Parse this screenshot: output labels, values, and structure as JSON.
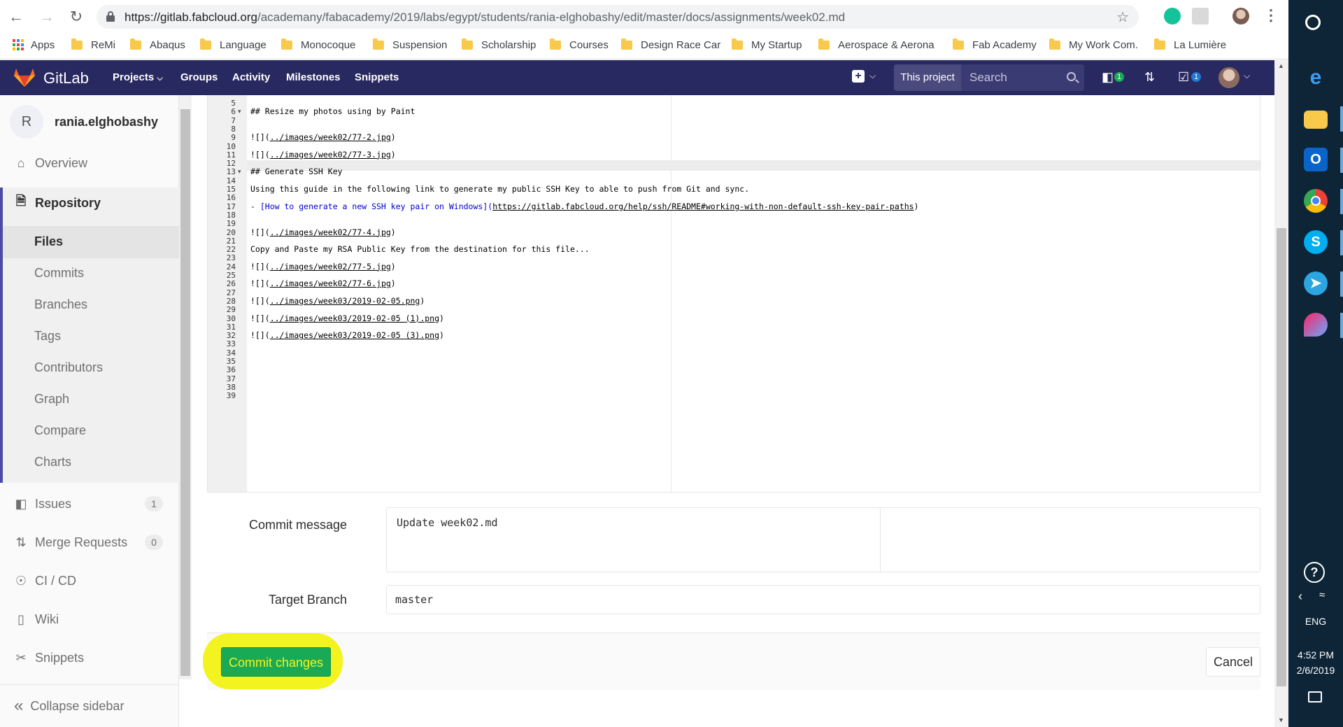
{
  "browser": {
    "url_host": "https://gitlab.fabcloud.org",
    "url_path": "/academany/fabacademy/2019/labs/egypt/students/rania-elghobashy/edit/master/docs/assignments/week02.md",
    "bookmarks": [
      "Apps",
      "ReMi",
      "Abaqus",
      "Language",
      "Monocoque",
      "Suspension",
      "Scholarship",
      "Courses",
      "Design Race Car",
      "My Startup",
      "Aerospace & Aerona",
      "Fab Academy",
      "My Work Com.",
      "La Lumière"
    ]
  },
  "header": {
    "brand": "GitLab",
    "nav": [
      "Projects",
      "Groups",
      "Activity",
      "Milestones",
      "Snippets"
    ],
    "search_scope": "This project",
    "search_placeholder": "Search",
    "issues_badge": "1",
    "todos_badge": "1"
  },
  "sidebar": {
    "avatar_letter": "R",
    "project_name": "rania.elghobashy",
    "overview": "Overview",
    "repository": "Repository",
    "repo_items": [
      "Files",
      "Commits",
      "Branches",
      "Tags",
      "Contributors",
      "Graph",
      "Compare",
      "Charts"
    ],
    "issues": "Issues",
    "issues_count": "1",
    "merge_requests": "Merge Requests",
    "merge_requests_count": "0",
    "cicd": "CI / CD",
    "wiki": "Wiki",
    "snippets": "Snippets",
    "collapse": "Collapse sidebar"
  },
  "editor": {
    "first_line": 5,
    "last_line": 39,
    "fold_lines": [
      6,
      13
    ],
    "active_line": 11,
    "lines": {
      "6": "## Resize my photos using by Paint",
      "9": "![](../images/week02/77-2.jpg)",
      "11": "![](../images/week02/77-3.jpg)",
      "13": "## Generate SSH Key",
      "15": "Using this guide in the following link to generate my public SSH Key to able to push from Git and sync.",
      "17": "- [How to generate a new SSH key pair on Windows](https://gitlab.fabcloud.org/help/ssh/README#working-with-non-default-ssh-key-pair-paths)",
      "20": "![](../images/week02/77-4.jpg)",
      "22": "Copy and Paste my RSA Public Key from the destination for this file...",
      "24": "![](../images/week02/77-5.jpg)",
      "26": "![](../images/week02/77-6.jpg)",
      "28": "![](../images/week03/2019-02-05.png)",
      "30": "![](../images/week03/2019-02-05 (1).png)",
      "32": "![](../images/week03/2019-02-05 (3).png)"
    }
  },
  "form": {
    "commit_label": "Commit message",
    "commit_value": "Update week02.md",
    "branch_label": "Target Branch",
    "branch_value": "master",
    "commit_button": "Commit changes",
    "cancel_button": "Cancel"
  },
  "taskbar": {
    "lang": "ENG",
    "time": "4:52 PM",
    "date": "2/6/2019"
  },
  "colors": {
    "gitlab_header": "#292961",
    "commit_green": "#1aaa55",
    "highlight_yellow": "#f3f320",
    "taskbar": "#0d2537"
  }
}
